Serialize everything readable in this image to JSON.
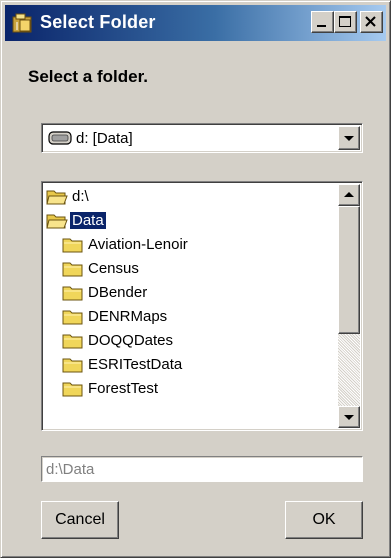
{
  "window": {
    "title": "Select Folder",
    "icon": "folder-tree-icon",
    "controls": [
      "minimize-icon",
      "maximize-icon",
      "close-icon"
    ]
  },
  "prompt": "Select a folder.",
  "drive_select": {
    "value": "d: [Data]",
    "icon": "drive-icon"
  },
  "tree": {
    "items": [
      {
        "label": "d:\\",
        "icon": "open-folder-icon",
        "selected": false,
        "depth": 0
      },
      {
        "label": "Data",
        "icon": "open-folder-icon",
        "selected": true,
        "depth": 0
      },
      {
        "label": "Aviation-Lenoir",
        "icon": "folder-icon",
        "selected": false,
        "depth": 1
      },
      {
        "label": "Census",
        "icon": "folder-icon",
        "selected": false,
        "depth": 1
      },
      {
        "label": "DBender",
        "icon": "folder-icon",
        "selected": false,
        "depth": 1
      },
      {
        "label": "DENRMaps",
        "icon": "folder-icon",
        "selected": false,
        "depth": 1
      },
      {
        "label": "DOQQDates",
        "icon": "folder-icon",
        "selected": false,
        "depth": 1
      },
      {
        "label": "ESRITestData",
        "icon": "folder-icon",
        "selected": false,
        "depth": 1
      },
      {
        "label": "ForestTest",
        "icon": "folder-icon",
        "selected": false,
        "depth": 1
      }
    ]
  },
  "path_field": {
    "value": "d:\\Data"
  },
  "buttons": {
    "cancel": "Cancel",
    "ok": "OK"
  },
  "colors": {
    "title_gradient_start": "#0a246a",
    "title_gradient_end": "#a6caf0",
    "selection": "#0a246a",
    "face": "#d4d0c8"
  }
}
